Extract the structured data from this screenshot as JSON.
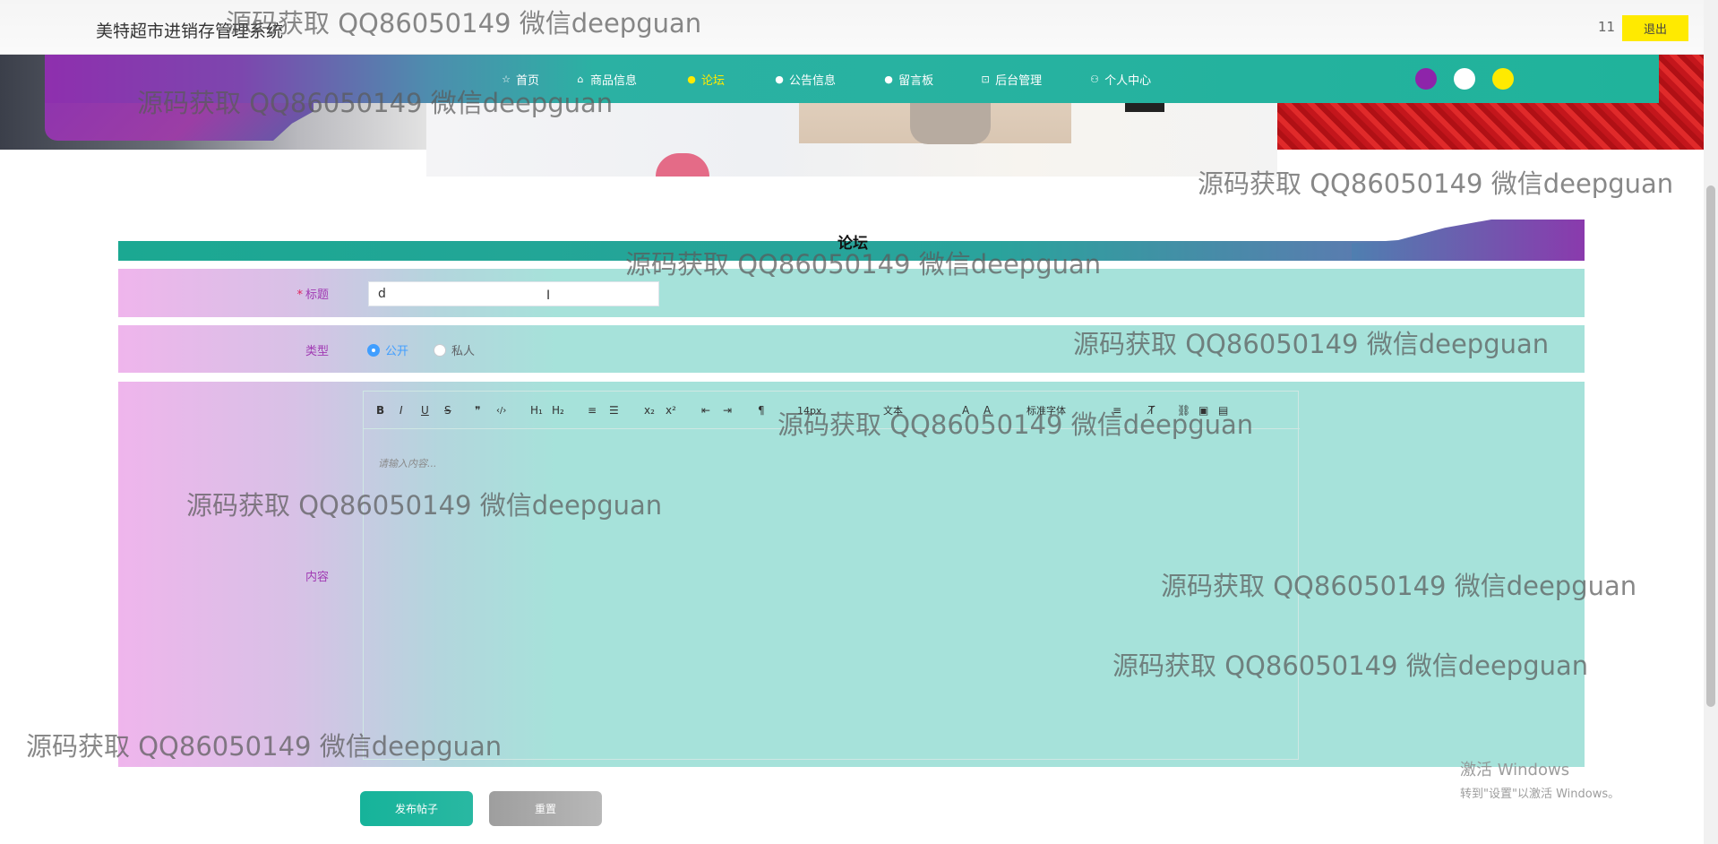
{
  "header": {
    "app_title": "美特超市进销存管理系统",
    "username": "11",
    "logout_label": "退出"
  },
  "nav": {
    "items": [
      {
        "label": "首页",
        "icon": "star-icon"
      },
      {
        "label": "商品信息",
        "icon": "house-icon"
      },
      {
        "label": "论坛",
        "icon": "info-circle-icon",
        "active": true
      },
      {
        "label": "公告信息",
        "icon": "info-circle-icon"
      },
      {
        "label": "留言板",
        "icon": "info-circle-icon"
      },
      {
        "label": "后台管理",
        "icon": "briefcase-icon"
      },
      {
        "label": "个人中心",
        "icon": "user-icon"
      }
    ],
    "theme_colors": [
      "#8e24aa",
      "#ffffff",
      "#ffea00"
    ],
    "active_color": "#ffea00"
  },
  "section": {
    "title": "论坛"
  },
  "form": {
    "title_label": "标题",
    "title_required_mark": "*",
    "title_value": "d",
    "type_label": "类型",
    "type_options": [
      {
        "label": "公开",
        "checked": true
      },
      {
        "label": "私人",
        "checked": false
      }
    ],
    "content_label": "内容",
    "editor_placeholder": "请输入内容...",
    "toolbar": [
      {
        "name": "bold-icon",
        "glyph": "B"
      },
      {
        "name": "italic-icon",
        "glyph": "I"
      },
      {
        "name": "underline-icon",
        "glyph": "U"
      },
      {
        "name": "strikethrough-icon",
        "glyph": "S"
      },
      {
        "name": "blockquote-icon",
        "glyph": "❞"
      },
      {
        "name": "code-block-icon",
        "glyph": "‹/›"
      },
      {
        "name": "header-1-icon",
        "glyph": "H₁"
      },
      {
        "name": "header-2-icon",
        "glyph": "H₂"
      },
      {
        "name": "ordered-list-icon",
        "glyph": "≡"
      },
      {
        "name": "bullet-list-icon",
        "glyph": "☰"
      },
      {
        "name": "subscript-icon",
        "glyph": "x₂"
      },
      {
        "name": "superscript-icon",
        "glyph": "x²"
      },
      {
        "name": "outdent-icon",
        "glyph": "⇤"
      },
      {
        "name": "indent-icon",
        "glyph": "⇥"
      },
      {
        "name": "text-direction-icon",
        "glyph": "¶"
      },
      {
        "name": "font-size-dropdown",
        "glyph": "14px"
      },
      {
        "name": "header-dropdown",
        "glyph": "文本"
      },
      {
        "name": "text-color-icon",
        "glyph": "A"
      },
      {
        "name": "background-color-icon",
        "glyph": "A"
      },
      {
        "name": "font-family-dropdown",
        "glyph": "标准字体"
      },
      {
        "name": "align-icon",
        "glyph": "≡"
      },
      {
        "name": "clear-format-icon",
        "glyph": "T̸"
      },
      {
        "name": "link-icon",
        "glyph": "⛓"
      },
      {
        "name": "image-icon",
        "glyph": "▣"
      },
      {
        "name": "video-icon",
        "glyph": "▤"
      }
    ],
    "submit_label": "发布帖子",
    "reset_label": "重置"
  },
  "watermark": {
    "text": "源码获取 QQ86050149 微信deepguan"
  },
  "windows_activation": {
    "line1": "激活 Windows",
    "line2": "转到\"设置\"以激活 Windows。"
  }
}
